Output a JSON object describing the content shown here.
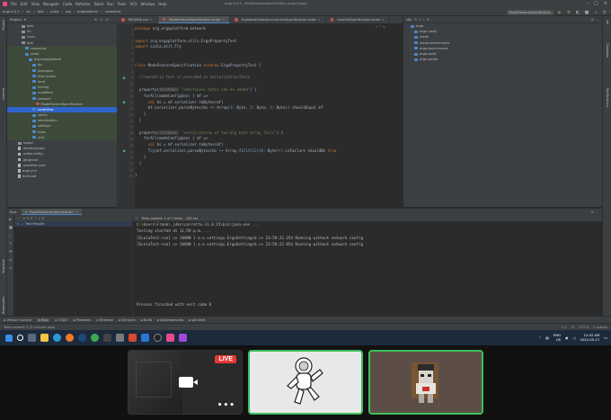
{
  "menubar": {
    "items": [
      "File",
      "Edit",
      "View",
      "Navigate",
      "Code",
      "Refactor",
      "Build",
      "Run",
      "Tools",
      "VCS",
      "Window",
      "Help"
    ],
    "title": "ergo-4.0.4 - ModeFeatureSpecification.scala [ergo]"
  },
  "navbar": {
    "breadcrumbs": [
      "ergo-4.0.4",
      "src",
      "test",
      "scala",
      "org",
      "ergoplatform",
      "nodeView"
    ],
    "run_config": "ModeFeatureSpecification"
  },
  "project_panel": {
    "title": "Project",
    "rows": [
      {
        "label": "test",
        "kind": "folder",
        "indent": 3,
        "state": ""
      },
      {
        "label": "it2",
        "kind": "folder",
        "indent": 3,
        "state": ""
      },
      {
        "label": "main",
        "kind": "folder",
        "indent": 3,
        "state": ""
      },
      {
        "label": "test",
        "kind": "folder",
        "indent": 3,
        "state": ""
      },
      {
        "label": "resources",
        "kind": "folder",
        "indent": 4,
        "state": "mod"
      },
      {
        "label": "scala",
        "kind": "folder",
        "indent": 4,
        "state": "mod"
      },
      {
        "label": "org.ergoplatform",
        "kind": "folder",
        "indent": 5,
        "state": "mod"
      },
      {
        "label": "db",
        "kind": "folder",
        "indent": 6,
        "state": "mod"
      },
      {
        "label": "examples",
        "kind": "folder",
        "indent": 6,
        "state": "mod"
      },
      {
        "label": "http.routes",
        "kind": "folder",
        "indent": 6,
        "state": "mod"
      },
      {
        "label": "local",
        "kind": "folder",
        "indent": 6,
        "state": "mod"
      },
      {
        "label": "mining",
        "kind": "folder",
        "indent": 6,
        "state": "mod"
      },
      {
        "label": "modifiers",
        "kind": "folder",
        "indent": 6,
        "state": "mod"
      },
      {
        "label": "network",
        "kind": "folder",
        "indent": 6,
        "state": "mod"
      },
      {
        "label": "ModeFeatureSpecification",
        "kind": "scala",
        "indent": 7,
        "state": "mod"
      },
      {
        "label": "nodeView",
        "kind": "folder",
        "indent": 6,
        "state": "selected"
      },
      {
        "label": "sanity",
        "kind": "folder",
        "indent": 6,
        "state": "mod"
      },
      {
        "label": "serialization",
        "kind": "folder",
        "indent": 6,
        "state": "mod"
      },
      {
        "label": "settings",
        "kind": "folder",
        "indent": 6,
        "state": "mod"
      },
      {
        "label": "tools",
        "kind": "folder",
        "indent": 6,
        "state": "mod"
      },
      {
        "label": "utils",
        "kind": "folder",
        "indent": 6,
        "state": "mod"
      },
      {
        "label": "target",
        "kind": "folder",
        "indent": 2,
        "state": ""
      },
      {
        "label": ".dockerignore",
        "kind": "file",
        "indent": 2,
        "state": ""
      },
      {
        "label": ".editorconfig",
        "kind": "file",
        "indent": 2,
        "state": ""
      },
      {
        "label": ".gitignore",
        "kind": "file",
        "indent": 2,
        "state": ""
      },
      {
        "label": ".scalafmt.conf",
        "kind": "file",
        "indent": 2,
        "state": ""
      },
      {
        "label": "ergo.yml",
        "kind": "file",
        "indent": 2,
        "state": ""
      },
      {
        "label": "build.sbt",
        "kind": "file",
        "indent": 2,
        "state": ""
      }
    ]
  },
  "editor": {
    "tabs": [
      {
        "label": "README.md",
        "active": false
      },
      {
        "label": "ModeFeatureSpecification.scala",
        "active": true
      },
      {
        "label": "ErgoNodeViewSynchronizerSpecification.scala",
        "active": false
      },
      {
        "label": "UtxoSetSpecification.scala",
        "active": false
      }
    ],
    "lines": [
      [
        {
          "t": "package ",
          "c": "kw"
        },
        {
          "t": "org.ergoplatform.network",
          "c": ""
        }
      ],
      [
        {
          "t": "",
          "c": ""
        }
      ],
      [
        {
          "t": "import ",
          "c": "kw"
        },
        {
          "t": "org.ergoplatform.utils.ErgoPropertyTest",
          "c": ""
        }
      ],
      [
        {
          "t": "import ",
          "c": "kw"
        },
        {
          "t": "scala.util.Try",
          "c": ""
        }
      ],
      [
        {
          "t": "",
          "c": ""
        }
      ],
      [
        {
          "t": "",
          "c": ""
        }
      ],
      [
        {
          "t": "class ",
          "c": "kw"
        },
        {
          "t": "ModeFeatureSpecification ",
          "c": ""
        },
        {
          "t": "extends ",
          "c": "kw"
        },
        {
          "t": "ErgoPropertyTest {",
          "c": ""
        }
      ],
      [
        {
          "t": "",
          "c": ""
        }
      ],
      [
        {
          "t": "  //roundtrip test is provided in SerializationTests",
          "c": "cmt"
        }
      ],
      [
        {
          "t": "",
          "c": ""
        }
      ],
      [
        {
          "t": "  property(",
          "c": ""
        },
        {
          "t": "testName:",
          "c": "hint"
        },
        {
          "t": " ",
          "c": ""
        },
        {
          "t": "\"additional bytes can be added\"",
          "c": "str"
        },
        {
          "t": ") {",
          "c": ""
        }
      ],
      [
        {
          "t": "    forAll(",
          "c": ""
        },
        {
          "t": "modeConfigGen",
          "c": ""
        },
        {
          "t": ") { mf =>",
          "c": ""
        }
      ],
      [
        {
          "t": "      ",
          "c": ""
        },
        {
          "t": "val ",
          "c": "kw"
        },
        {
          "t": "bs = mf.serializer.toBytes(mf)",
          "c": ""
        }
      ],
      [
        {
          "t": "      mf.serializer.parseBytes(bs ++ Array(",
          "c": ""
        },
        {
          "t": "1",
          "c": "num"
        },
        {
          "t": ": Byte, ",
          "c": ""
        },
        {
          "t": "2",
          "c": "num"
        },
        {
          "t": ": Byte, ",
          "c": ""
        },
        {
          "t": "3",
          "c": "num"
        },
        {
          "t": ": Byte)) shouldEqual mf",
          "c": ""
        }
      ],
      [
        {
          "t": "    }",
          "c": ""
        }
      ],
      [
        {
          "t": "  }",
          "c": ""
        }
      ],
      [
        {
          "t": "",
          "c": ""
        }
      ],
      [
        {
          "t": "  property(",
          "c": ""
        },
        {
          "t": "testName:",
          "c": "hint"
        },
        {
          "t": " ",
          "c": ""
        },
        {
          "t": "\"serialization of too big byte array fails\"",
          "c": "str"
        },
        {
          "t": ") {",
          "c": ""
        }
      ],
      [
        {
          "t": "    forAll(",
          "c": ""
        },
        {
          "t": "modeConfigGen",
          "c": ""
        },
        {
          "t": ") { mf =>",
          "c": ""
        }
      ],
      [
        {
          "t": "      ",
          "c": ""
        },
        {
          "t": "val ",
          "c": "kw"
        },
        {
          "t": "bs = mf.serializer.toBytes(mf)",
          "c": ""
        }
      ],
      [
        {
          "t": "      Try(mf.serializer.parseBytes(bs ++ Array.fill(",
          "c": ""
        },
        {
          "t": "512",
          "c": "num"
        },
        {
          "t": ")(",
          "c": ""
        },
        {
          "t": "0",
          "c": "num"
        },
        {
          "t": ": Byte))).isFailure shouldBe ",
          "c": ""
        },
        {
          "t": "true",
          "c": "kw"
        }
      ],
      [
        {
          "t": "    }",
          "c": ""
        }
      ],
      [
        {
          "t": "  }",
          "c": ""
        }
      ],
      [
        {
          "t": "",
          "c": ""
        }
      ],
      [
        {
          "t": "}",
          "c": ""
        }
      ]
    ]
  },
  "sbt_panel": {
    "title": "sbt",
    "rows": [
      {
        "label": "ergo",
        "indent": 1
      },
      {
        "label": "ergo (root)",
        "indent": 2
      },
      {
        "label": "avldb",
        "indent": 2
      },
      {
        "label": "avldb-benchmarks",
        "indent": 2
      },
      {
        "label": "ergo-benchmarks",
        "indent": 2
      },
      {
        "label": "ergo-build",
        "indent": 2
      },
      {
        "label": "ergo-wallet",
        "indent": 2
      }
    ]
  },
  "run_panel": {
    "label": "Run:",
    "tab": "ModeFeatureSpecification",
    "status": "Tests passed: 2 of 2 tests – 183 ms",
    "test_results": "Test Results",
    "console_lines": [
      "C:\\Users\\Frank\\.jdks\\corretto-11.0.15\\bin\\java.exe ...",
      "Testing started at 11:59 p.m. ...",
      "[ScalaTest-run] >> [WARN ] o.e.settings.ErgoSettings$ >> 23:59:22.254 Running without network config",
      "[ScalaTest-run] >> [WARN ] o.e.settings.ErgoSettings$ >> 23:59:22.954 Running without network config",
      "",
      "",
      "",
      "",
      "",
      "",
      "",
      "",
      "Process finished with exit code 0"
    ]
  },
  "toolwindows": [
    "Version Control",
    "Run",
    "TODO",
    "Problems",
    "Terminal",
    "Services",
    "Build",
    "Dependencies",
    "sbt shell"
  ],
  "statusbar": {
    "left": "Tests passed: 2 (2 minutes ago)",
    "right": [
      "1:1",
      "LF",
      "UTF-8",
      "2 spaces"
    ]
  },
  "taskbar": {
    "lang": "ENG",
    "locale": "US",
    "time": "12:02 AM",
    "date": "2022-05-27"
  },
  "video_call": {
    "live_label": "LIVE",
    "more_label": "•••"
  },
  "colors": {
    "accent": "#4a88c7",
    "selection": "#2f65ca",
    "success": "#59a869",
    "live": "#e53935",
    "tile_border": "#3dbf5a"
  }
}
